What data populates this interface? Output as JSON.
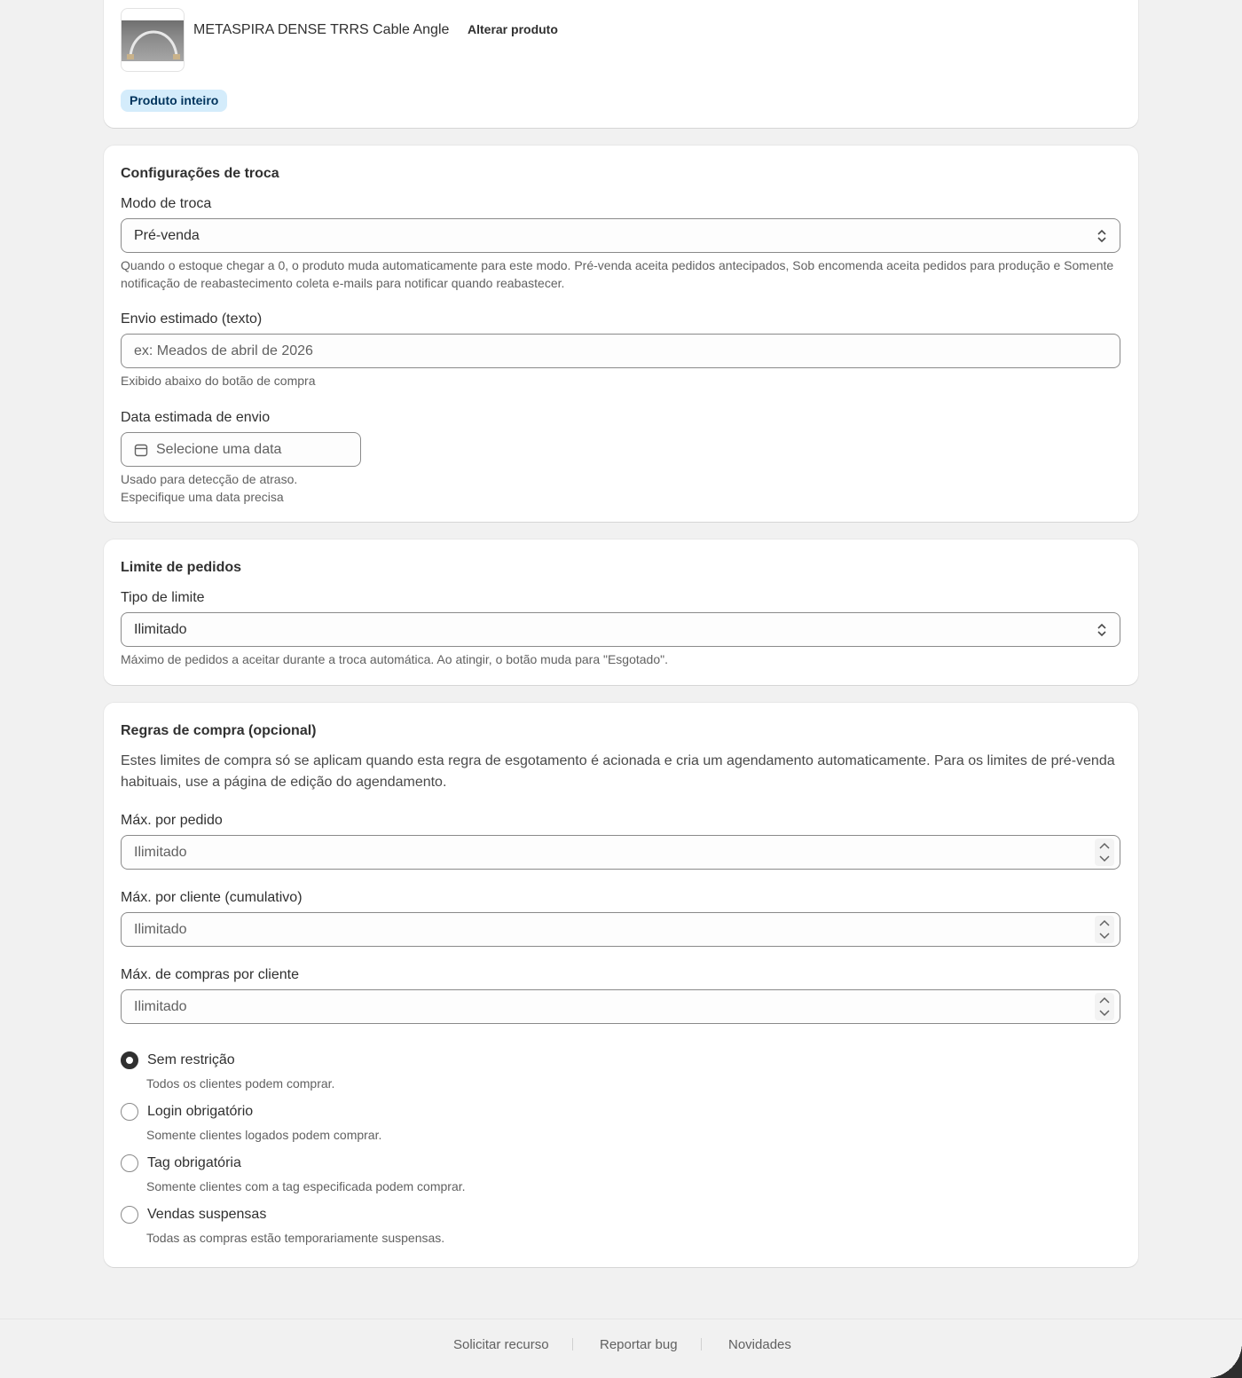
{
  "product": {
    "name": "METASPIRA DENSE TRRS Cable Angle",
    "change_label": "Alterar produto",
    "badge": "Produto inteiro"
  },
  "exchange": {
    "title": "Configurações de troca",
    "mode_label": "Modo de troca",
    "mode_value": "Pré-venda",
    "mode_help": "Quando o estoque chegar a 0, o produto muda automaticamente para este modo. Pré-venda aceita pedidos antecipados, Sob encomenda aceita pedidos para produção e Somente notificação de reabastecimento coleta e-mails para notificar quando reabastecer.",
    "ship_text_label": "Envio estimado (texto)",
    "ship_text_placeholder": "ex: Meados de abril de 2026",
    "ship_text_help": "Exibido abaixo do botão de compra",
    "ship_date_label": "Data estimada de envio",
    "ship_date_placeholder": "Selecione uma data",
    "ship_date_help_1": "Usado para detecção de atraso.",
    "ship_date_help_2": "Especifique uma data precisa"
  },
  "limit": {
    "title": "Limite de pedidos",
    "type_label": "Tipo de limite",
    "type_value": "Ilimitado",
    "type_help": "Máximo de pedidos a aceitar durante a troca automática. Ao atingir, o botão muda para \"Esgotado\"."
  },
  "rules": {
    "title": "Regras de compra (opcional)",
    "description": "Estes limites de compra só se aplicam quando esta regra de esgotamento é acionada e cria um agendamento automaticamente. Para os limites de pré-venda habituais, use a página de edição do agendamento.",
    "max_per_order_label": "Máx. por pedido",
    "max_per_order_placeholder": "Ilimitado",
    "max_per_customer_label": "Máx. por cliente (cumulativo)",
    "max_per_customer_placeholder": "Ilimitado",
    "max_purchases_label": "Máx. de compras por cliente",
    "max_purchases_placeholder": "Ilimitado",
    "options": [
      {
        "label": "Sem restrição",
        "help": "Todos os clientes podem comprar.",
        "checked": true
      },
      {
        "label": "Login obrigatório",
        "help": "Somente clientes logados podem comprar.",
        "checked": false
      },
      {
        "label": "Tag obrigatória",
        "help": "Somente clientes com a tag especificada podem comprar.",
        "checked": false
      },
      {
        "label": "Vendas suspensas",
        "help": "Todas as compras estão temporariamente suspensas.",
        "checked": false
      }
    ]
  },
  "footer": {
    "request_feature": "Solicitar recurso",
    "report_bug": "Reportar bug",
    "news": "Novidades"
  }
}
